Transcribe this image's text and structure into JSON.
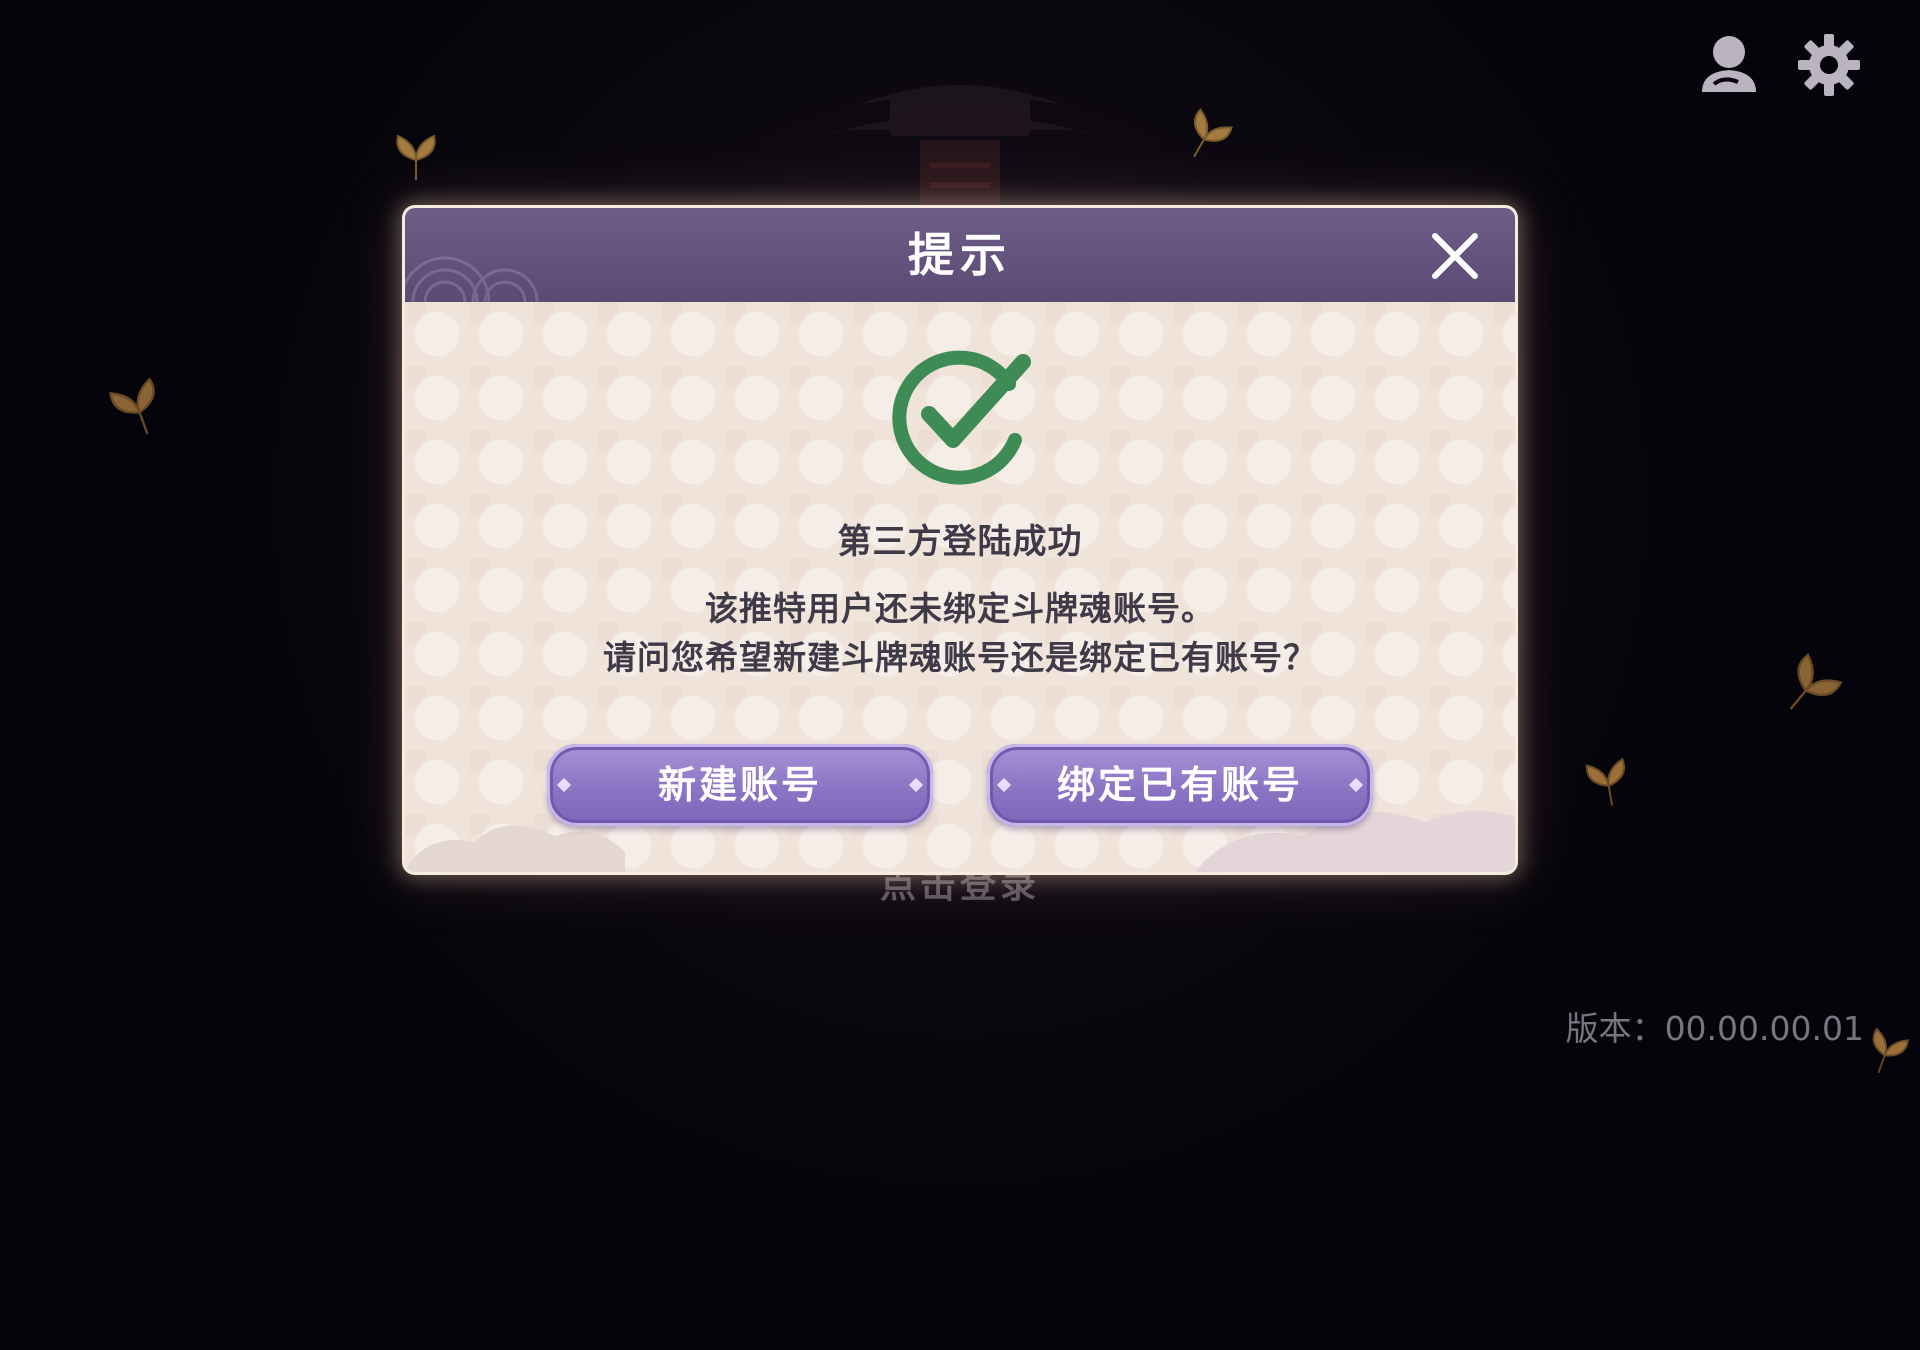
{
  "dialog": {
    "title": "提示",
    "success_text": "第三方登陆成功",
    "message_line1": "该推特用户还未绑定斗牌魂账号。",
    "message_line2": "请问您希望新建斗牌魂账号还是绑定已有账号？",
    "new_account_label": "新建账号",
    "bind_account_label": "绑定已有账号"
  },
  "background": {
    "login_prompt": "点击登录"
  },
  "footer": {
    "version_label": "版本：00.00.00.01"
  },
  "icons": {
    "top_bar": [
      "user-icon",
      "gear-icon"
    ],
    "dialog": [
      "close-icon",
      "checkmark-icon"
    ]
  },
  "colors": {
    "header": "#5e4e78",
    "panel": "#efe3da",
    "button": "#8f79c8",
    "check": "#3f8b55",
    "text": "#3f3a48"
  }
}
